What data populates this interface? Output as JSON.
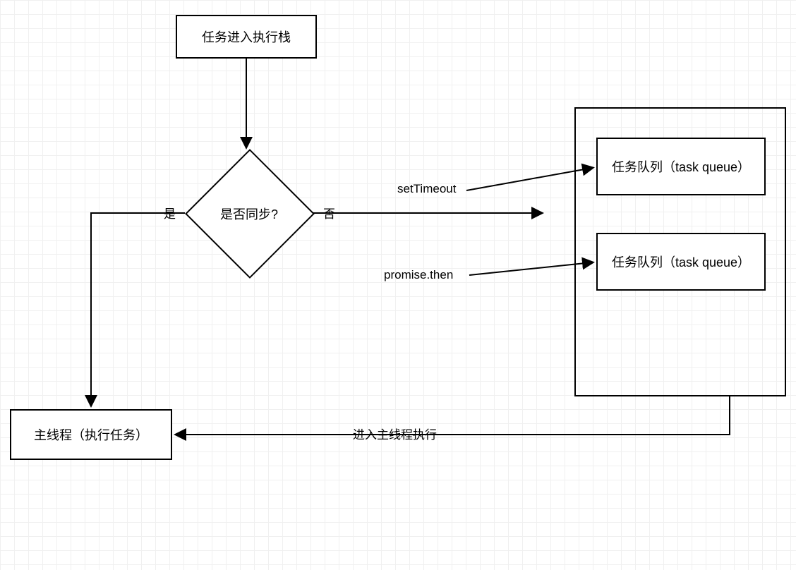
{
  "nodes": {
    "start": {
      "label": "任务进入执行栈"
    },
    "decision": {
      "label": "是否同步?"
    },
    "main_thread": {
      "label": "主线程（执行任务）"
    },
    "task_queue_1": {
      "label": "任务队列（task queue）"
    },
    "task_queue_2": {
      "label": "任务队列（task queue）"
    }
  },
  "edges": {
    "yes": {
      "label": "是"
    },
    "no": {
      "label": "否"
    },
    "setTimeout": {
      "label": "setTimeout"
    },
    "promiseThen": {
      "label": "promise.then"
    },
    "enterMain": {
      "label": "进入主线程执行"
    }
  }
}
